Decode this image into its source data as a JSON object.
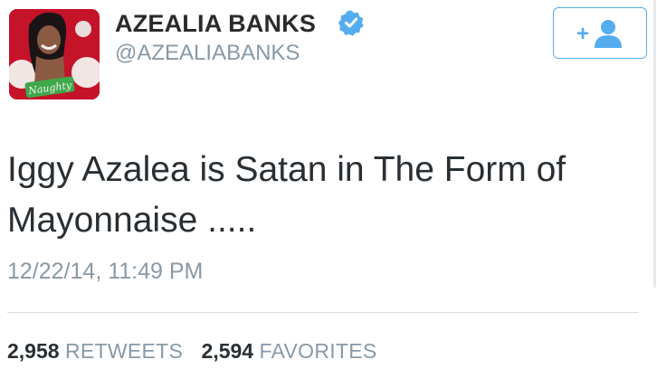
{
  "profile": {
    "display_name": "AZEALIA BANKS",
    "handle": "@AZEALIABANKS",
    "verified": true,
    "avatar_caption": "Naughty"
  },
  "follow_button": {
    "icon": "add-user-icon",
    "plus_glyph": "+"
  },
  "tweet": {
    "text": "Iggy Azalea is Satan in The Form of Mayonnaise .....",
    "timestamp": "12/22/14, 11:49 PM"
  },
  "stats": {
    "retweets_count": "2,958",
    "retweets_label": "RETWEETS",
    "favorites_count": "2,594",
    "favorites_label": "FAVORITES"
  },
  "colors": {
    "accent": "#55acee",
    "muted": "#8899a6",
    "text": "#292f33",
    "avatar_bg": "#c5132a"
  }
}
